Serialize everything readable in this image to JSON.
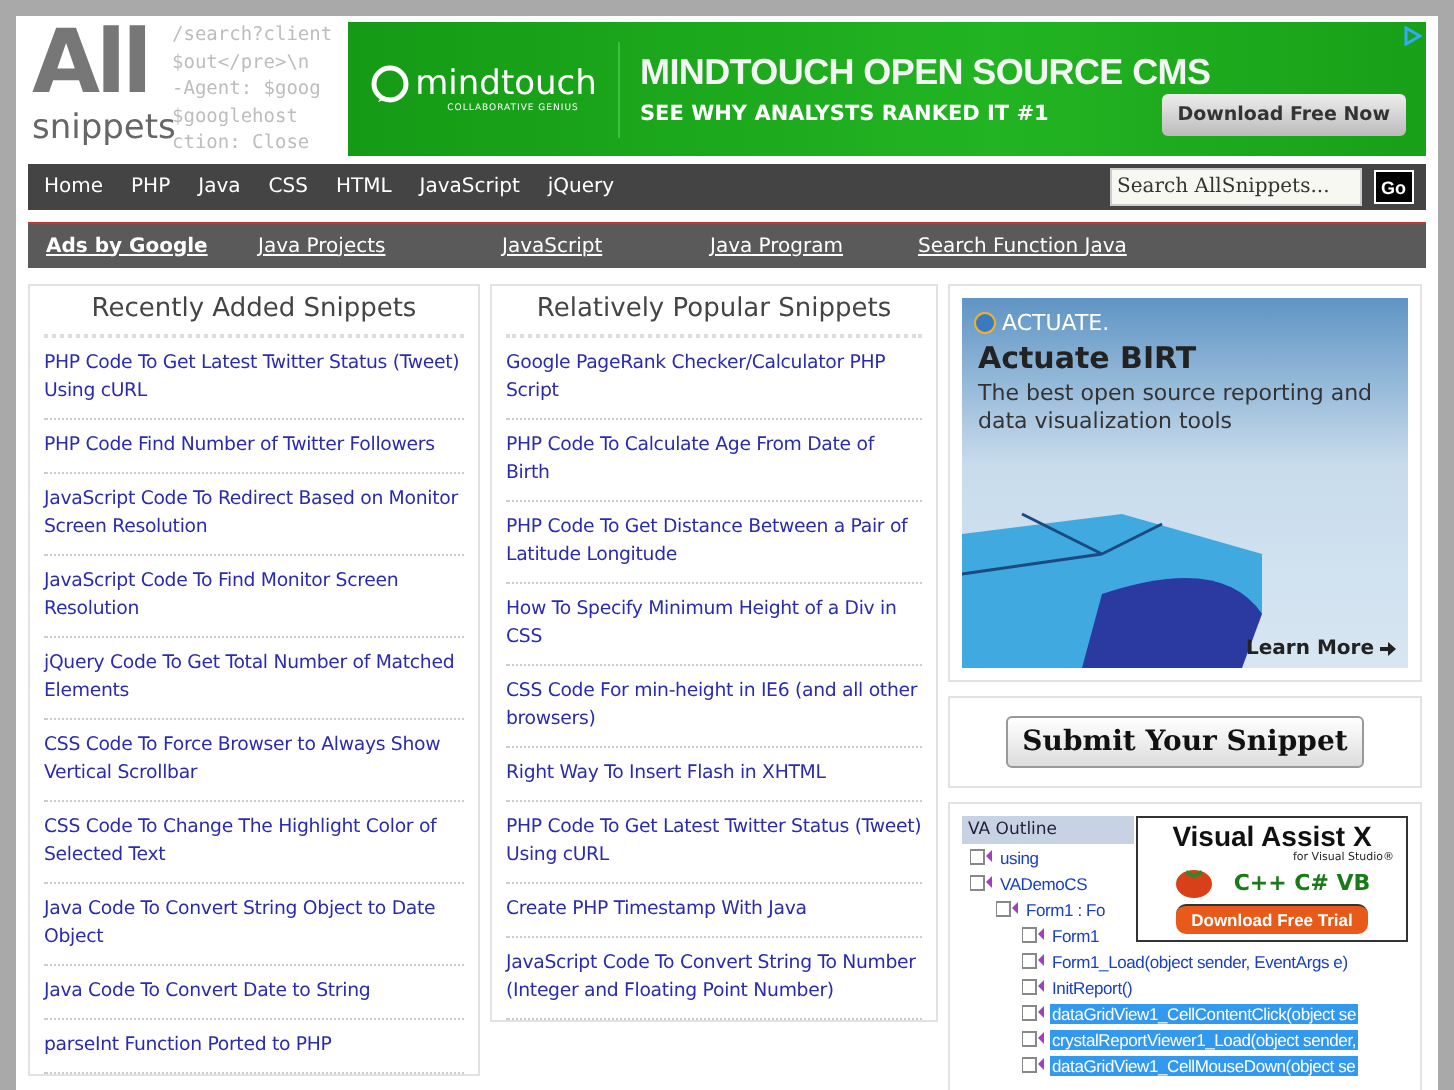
{
  "logo": {
    "word_top": "All",
    "word_bottom": "snippets",
    "code_lines": [
      "/search?client",
      "$out</pre>\\n",
      "-Agent: $goog",
      "$googlehost",
      "ction: Close"
    ]
  },
  "top_banner": {
    "brand": "mindtouch",
    "brand_tagline": "COLLABORATIVE GENIUS",
    "headline": "MINDTOUCH OPEN SOURCE CMS",
    "subline": "SEE WHY ANALYSTS RANKED IT #1",
    "button": "Download Free Now"
  },
  "nav": {
    "items": [
      "Home",
      "PHP",
      "Java",
      "CSS",
      "HTML",
      "JavaScript",
      "jQuery"
    ],
    "search": {
      "placeholder": "Search AllSnippets..."
    },
    "go": "Go"
  },
  "ad_links": {
    "label": "Ads by Google",
    "links": [
      "Java Projects",
      "JavaScript",
      "Java Program",
      "Search Function Java"
    ]
  },
  "recent": {
    "title": "Recently Added Snippets",
    "items": [
      "PHP Code To Get Latest Twitter Status (Tweet) Using cURL",
      "PHP Code Find Number of Twitter Followers",
      "JavaScript Code To Redirect Based on Monitor Screen Resolution",
      "JavaScript Code To Find Monitor Screen Resolution",
      "jQuery Code To Get Total Number of Matched Elements",
      "CSS Code To Force Browser to Always Show Vertical Scrollbar",
      "CSS Code To Change The Highlight Color of Selected Text",
      "Java Code To Convert String Object to Date Object",
      "Java Code To Convert Date to String",
      "parseInt Function Ported to PHP"
    ]
  },
  "popular": {
    "title": "Relatively Popular Snippets",
    "items": [
      "Google PageRank Checker/Calculator PHP Script",
      "PHP Code To Calculate Age From Date of Birth",
      "PHP Code To Get Distance Between a Pair of Latitude Longitude",
      "How To Specify Minimum Height of a Div in CSS",
      "CSS Code For min-height in IE6 (and all other browsers)",
      "Right Way To Insert Flash in XHTML",
      "PHP Code To Get Latest Twitter Status (Tweet) Using cURL",
      "Create PHP Timestamp With Java",
      "JavaScript Code To Convert String To Number (Integer and Floating Point Number)"
    ]
  },
  "side_ad": {
    "brand": "ACTUATE.",
    "title": "Actuate BIRT",
    "text": "The best open source reporting and data visualization tools",
    "cta": "Learn More"
  },
  "submit_button": "Submit Your Snippet",
  "va_ad": {
    "outline_title": "VA Outline",
    "tree": [
      {
        "label": "using",
        "selected": false
      },
      {
        "label": "VADemoCS",
        "selected": false,
        "children": [
          {
            "label": "Form1 : Fo",
            "selected": false,
            "children": [
              {
                "label": "Form1",
                "selected": false
              },
              {
                "label": "Form1_Load(object sender, EventArgs e)",
                "selected": false
              },
              {
                "label": "InitReport()",
                "selected": false
              },
              {
                "label": "dataGridView1_CellContentClick(object se",
                "selected": true
              },
              {
                "label": "crystalReportViewer1_Load(object sender,",
                "selected": true
              },
              {
                "label": "dataGridView1_CellMouseDown(object se",
                "selected": true
              }
            ]
          }
        ]
      }
    ],
    "title": "Visual Assist X",
    "subtitle": "for Visual Studio®",
    "languages": "C++ C# VB",
    "button": "Download Free Trial"
  }
}
